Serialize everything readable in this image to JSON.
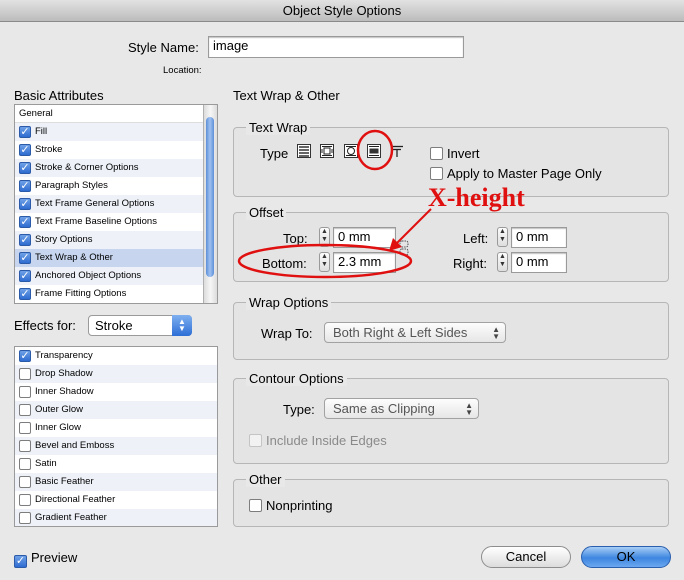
{
  "window": {
    "title": "Object Style Options"
  },
  "style_name": {
    "label": "Style Name:",
    "value": "image"
  },
  "location": {
    "label": "Location:"
  },
  "basic_attributes": {
    "heading": "Basic Attributes",
    "items": [
      {
        "label": "General",
        "checkbox": false
      },
      {
        "label": "Fill",
        "checked": true
      },
      {
        "label": "Stroke",
        "checked": true
      },
      {
        "label": "Stroke & Corner Options",
        "checked": true
      },
      {
        "label": "Paragraph Styles",
        "checked": true
      },
      {
        "label": "Text Frame General Options",
        "checked": true
      },
      {
        "label": "Text Frame Baseline Options",
        "checked": true
      },
      {
        "label": "Story Options",
        "checked": true
      },
      {
        "label": "Text Wrap & Other",
        "checked": true,
        "selected": true
      },
      {
        "label": "Anchored Object Options",
        "checked": true
      },
      {
        "label": "Frame Fitting Options",
        "checked": true
      }
    ]
  },
  "effects_for": {
    "label": "Effects for:",
    "value": "Stroke",
    "items": [
      {
        "label": "Transparency",
        "checked": true
      },
      {
        "label": "Drop Shadow",
        "checked": false
      },
      {
        "label": "Inner Shadow",
        "checked": false
      },
      {
        "label": "Outer Glow",
        "checked": false
      },
      {
        "label": "Inner Glow",
        "checked": false
      },
      {
        "label": "Bevel and Emboss",
        "checked": false
      },
      {
        "label": "Satin",
        "checked": false
      },
      {
        "label": "Basic Feather",
        "checked": false
      },
      {
        "label": "Directional Feather",
        "checked": false
      },
      {
        "label": "Gradient Feather",
        "checked": false
      }
    ]
  },
  "panel": {
    "title": "Text Wrap & Other"
  },
  "text_wrap": {
    "title": "Text Wrap",
    "type_label": "Type",
    "invert_label": "Invert",
    "apply_master_label": "Apply to Master Page Only"
  },
  "offset": {
    "title": "Offset",
    "top_label": "Top:",
    "top_value": "0 mm",
    "bottom_label": "Bottom:",
    "bottom_value": "2.3 mm",
    "left_label": "Left:",
    "left_value": "0 mm",
    "right_label": "Right:",
    "right_value": "0 mm"
  },
  "wrap_options": {
    "title": "Wrap Options",
    "wrap_to_label": "Wrap To:",
    "wrap_to_value": "Both Right & Left Sides"
  },
  "contour_options": {
    "title": "Contour Options",
    "type_label": "Type:",
    "type_value": "Same as Clipping",
    "include_inside_edges_label": "Include Inside Edges"
  },
  "other": {
    "title": "Other",
    "nonprinting_label": "Nonprinting"
  },
  "footer": {
    "preview_label": "Preview",
    "cancel_label": "Cancel",
    "ok_label": "OK"
  },
  "annotation": {
    "text": "X-height",
    "color": "#e01010"
  }
}
